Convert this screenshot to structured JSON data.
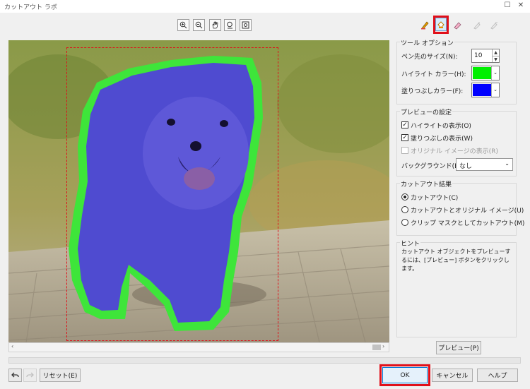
{
  "window": {
    "title": "カットアウト ラボ"
  },
  "toolbar": {
    "tools": [
      "zoom-in-icon",
      "zoom-out-icon",
      "hand-icon",
      "zoom-fit-icon",
      "fit-screen-icon"
    ],
    "right_tools": [
      "highlighter-icon",
      "fill-icon",
      "eraser-icon",
      "add-detail-icon",
      "remove-detail-icon"
    ]
  },
  "colors": {
    "highlight": "#00f000",
    "fill": "#0000ff",
    "accent_red": "#e0101a"
  },
  "tool_options": {
    "title": "ツール オプション",
    "nib_label": "ペン先のサイズ(N):",
    "nib_value": "10",
    "highlight_label": "ハイライト カラー(H):",
    "fill_label": "塗りつぶしカラー(F):"
  },
  "preview_settings": {
    "title": "プレビューの設定",
    "show_highlight": "ハイライトの表示(O)",
    "show_fill": "塗りつぶしの表示(W)",
    "show_original": "オリジナル イメージの表示(R)",
    "background_label": "バックグラウンド(B):",
    "background_value": "なし"
  },
  "cutout_result": {
    "title": "カットアウト結果",
    "opt1": "カットアウト(C)",
    "opt2": "カットアウトとオリジナル イメージ(U)",
    "opt3": "クリップ マスクとしてカットアウト(M)"
  },
  "hint": {
    "title": "ヒント",
    "text": "カットアウト オブジェクトをプレビューするには、[プレビュー] ボタンをクリックします。"
  },
  "buttons": {
    "preview": "プレビュー(P)",
    "reset": "リセット(E)",
    "ok": "OK",
    "cancel": "キャンセル",
    "help": "ヘルプ"
  }
}
